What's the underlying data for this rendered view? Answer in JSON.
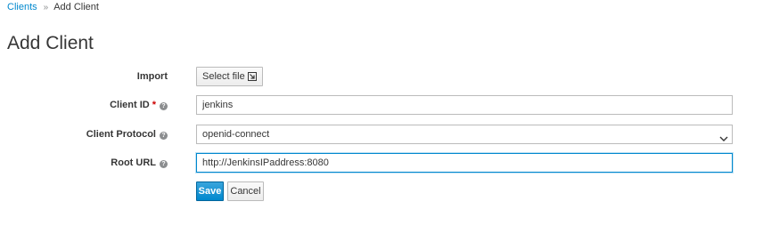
{
  "breadcrumb": {
    "parent": "Clients",
    "separator": "»",
    "current": "Add Client"
  },
  "page_title": "Add Client",
  "form": {
    "import": {
      "label": "Import",
      "button_label": "Select file"
    },
    "client_id": {
      "label": "Client ID",
      "required_mark": "*",
      "value": "jenkins"
    },
    "client_protocol": {
      "label": "Client Protocol",
      "value": "openid-connect"
    },
    "root_url": {
      "label": "Root URL",
      "value": "http://JenkinsIPaddress:8080"
    },
    "help_glyph": "?"
  },
  "actions": {
    "save_label": "Save",
    "cancel_label": "Cancel"
  },
  "colors": {
    "accent": "#0088ce",
    "required": "#cc0000",
    "text": "#363636"
  },
  "icons": [
    "chevron-right-icon",
    "help-icon",
    "file-import-icon",
    "chevron-down-icon"
  ]
}
